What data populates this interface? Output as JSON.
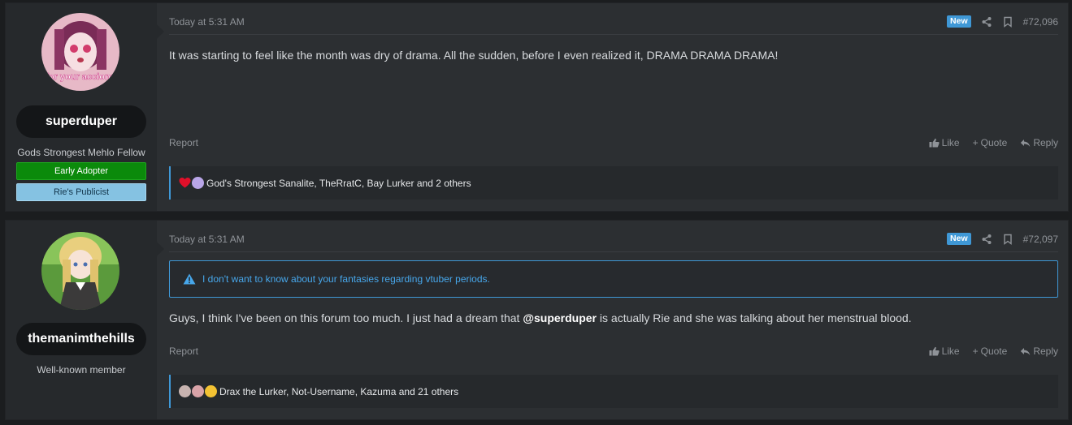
{
  "posts": [
    {
      "user": {
        "name": "superduper",
        "title": "Gods Strongest Mehlo Fellow",
        "banners": [
          "Early Adopter",
          "Rie's Publicist"
        ],
        "avatar_text": "for your accions"
      },
      "date": "Today at 5:31 AM",
      "badge": "New",
      "number": "#72,096",
      "message": "It was starting to feel like the month was dry of drama. All the sudden, before I even realized it, DRAMA DRAMA DRAMA!",
      "report": "Report",
      "actions": {
        "like": "Like",
        "quote": "Quote",
        "reply": "Reply"
      },
      "reactions": "God's Strongest Sanalite, TheRratC, Bay Lurker and 2 others"
    },
    {
      "user": {
        "name": "themanimthehills",
        "title": "Well-known member"
      },
      "date": "Today at 5:31 AM",
      "badge": "New",
      "number": "#72,097",
      "notice": "I don't want to know about your fantasies regarding vtuber periods.",
      "message_before": "Guys, I think I've been on this forum too much. I just had a dream that ",
      "mention": "@superduper",
      "message_after": " is actually Rie and she was talking about her menstrual blood.",
      "report": "Report",
      "actions": {
        "like": "Like",
        "quote": "Quote",
        "reply": "Reply"
      },
      "reactions": "Drax the Lurker, Not-Username, Kazuma and 21 others"
    }
  ],
  "colors": {
    "accent": "#3f98d6",
    "banner_green": "#0b8a0b",
    "banner_blue": "#85c2e2"
  }
}
